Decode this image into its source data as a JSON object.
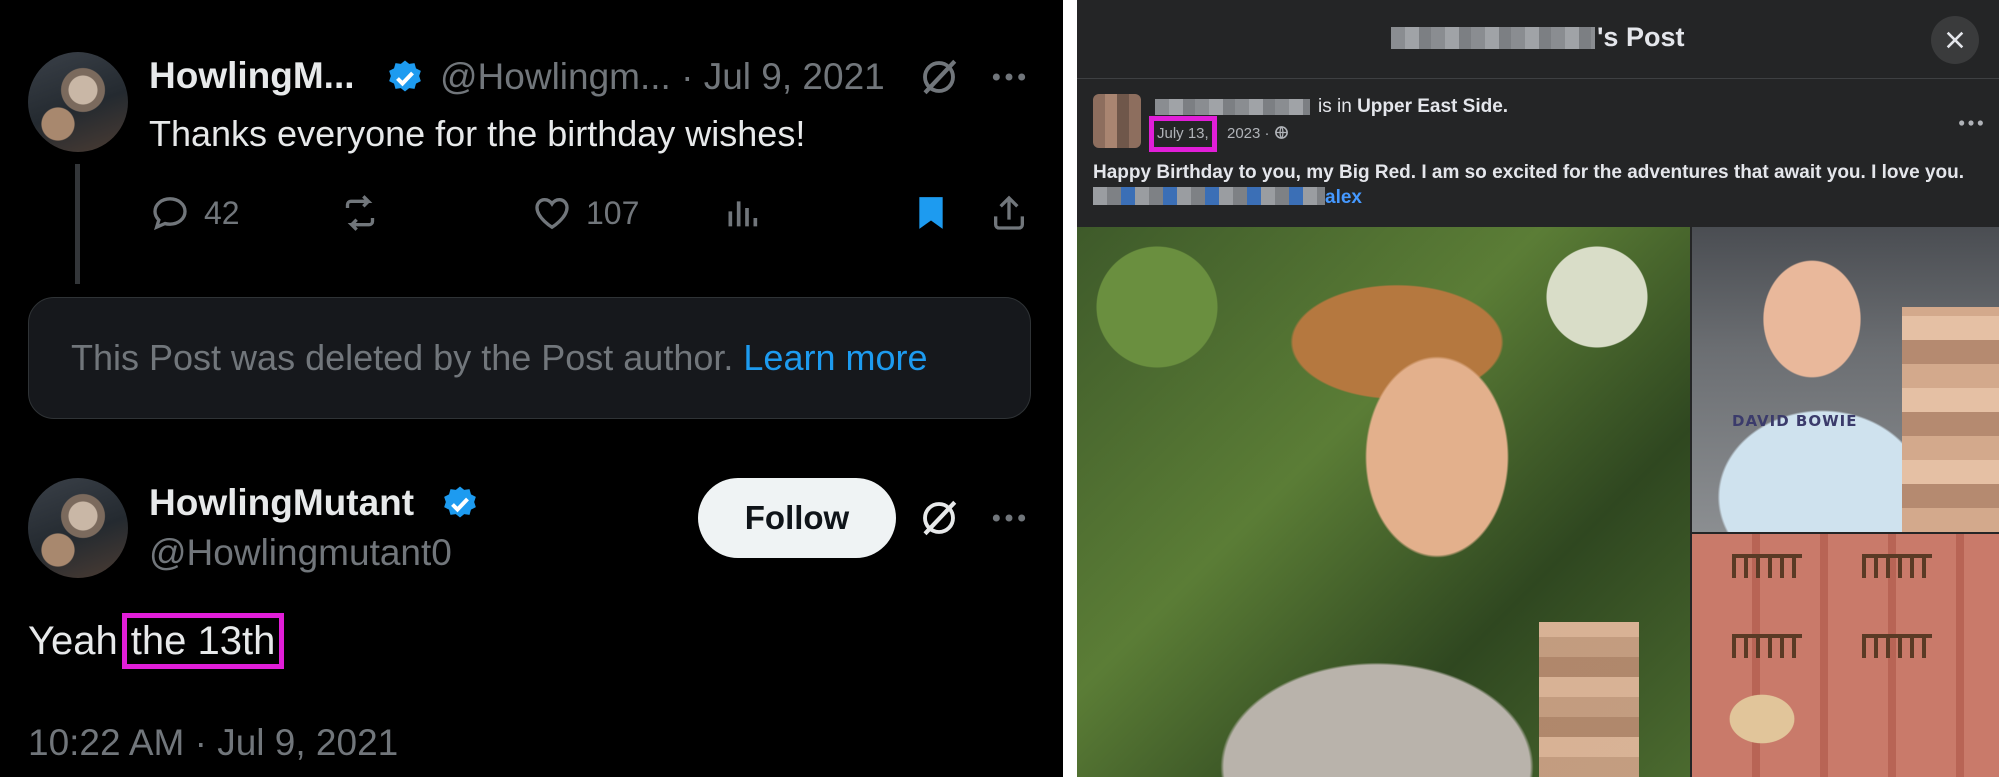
{
  "left_panel": {
    "tweet1": {
      "display_name": "HowlingM...",
      "handle_date": "@Howlingm... · Jul 9, 2021",
      "text": "Thanks everyone for the birthday wishes!",
      "reply_count": "42",
      "like_count": "107"
    },
    "deleted_notice": {
      "text": "This Post was deleted by the Post author.",
      "link": "Learn more"
    },
    "tweet2": {
      "display_name": "HowlingMutant",
      "handle": "@Howlingmutant0",
      "follow_label": "Follow",
      "text_prefix": "Yeah",
      "text_highlight": "the 13th",
      "timestamp": "10:22 AM · Jul 9, 2021"
    }
  },
  "right_panel": {
    "header_title_suffix": "'s Post",
    "location_prefix": "is in",
    "location": "Upper East Side.",
    "date_highlight": "July 13,",
    "date_rest": "2023 ·",
    "body_text": "Happy Birthday to you, my Big Red. I am so excited for the adventures that await you. I love you.",
    "tag_suffix": "alex",
    "photo_text": "DAVID BOWIE"
  },
  "colors": {
    "highlight": "#e11ed8",
    "twitter_blue": "#1d9bf0",
    "facebook_bg": "#242526"
  },
  "icons": [
    "verified-badge-icon",
    "reply-icon",
    "repost-icon",
    "like-icon",
    "views-icon",
    "bookmark-icon",
    "share-icon",
    "grok-icon",
    "more-icon",
    "close-icon",
    "globe-icon"
  ]
}
